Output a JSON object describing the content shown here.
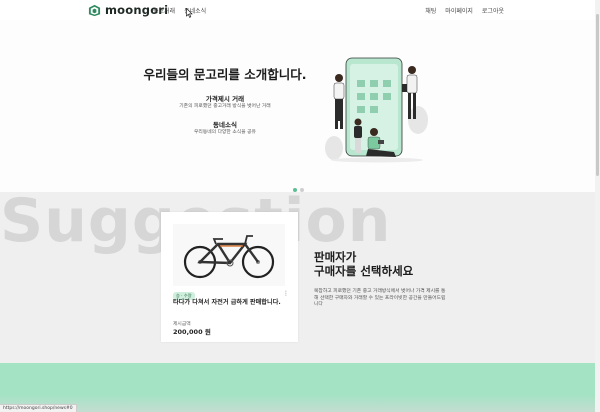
{
  "header": {
    "logo_text": "moongori",
    "nav_left": [
      "중고거래",
      "동네소식"
    ],
    "nav_right": [
      "채팅",
      "마이페이지",
      "로그아웃"
    ]
  },
  "hero": {
    "title": "우리들의 문고리를 소개합니다.",
    "features": [
      {
        "title": "가격제시 거래",
        "desc": "기존의 피로했던 중고거래 방식을 벗어난 거래"
      },
      {
        "title": "동네소식",
        "desc": "우리동네의 다양한 소식을 공유"
      }
    ],
    "carousel_active": 1,
    "carousel_count": 2
  },
  "suggestion": {
    "background_word": "Suggestion",
    "card": {
      "badge": "승 · 수량",
      "title": "타다가 다쳐서 자전거 급하게 판매합니다.",
      "price_label": "제시금액",
      "price": "200,000 원"
    },
    "heading_line1": "판매자가",
    "heading_line2": "구매자를 선택하세요",
    "description": "복잡하고 피로했던 기존 중고 거래방식에서 벗어나 가격 제시를 통해 선택한 구매자와 거래할 수 있는 프라이빗한 공간을 만들어드립니다"
  },
  "status_bar": {
    "url": "https://moongori.shop/news#0"
  },
  "colors": {
    "accent": "#5fbf94",
    "strip": "#a5e3c5",
    "logo": "#2f8a5f"
  }
}
